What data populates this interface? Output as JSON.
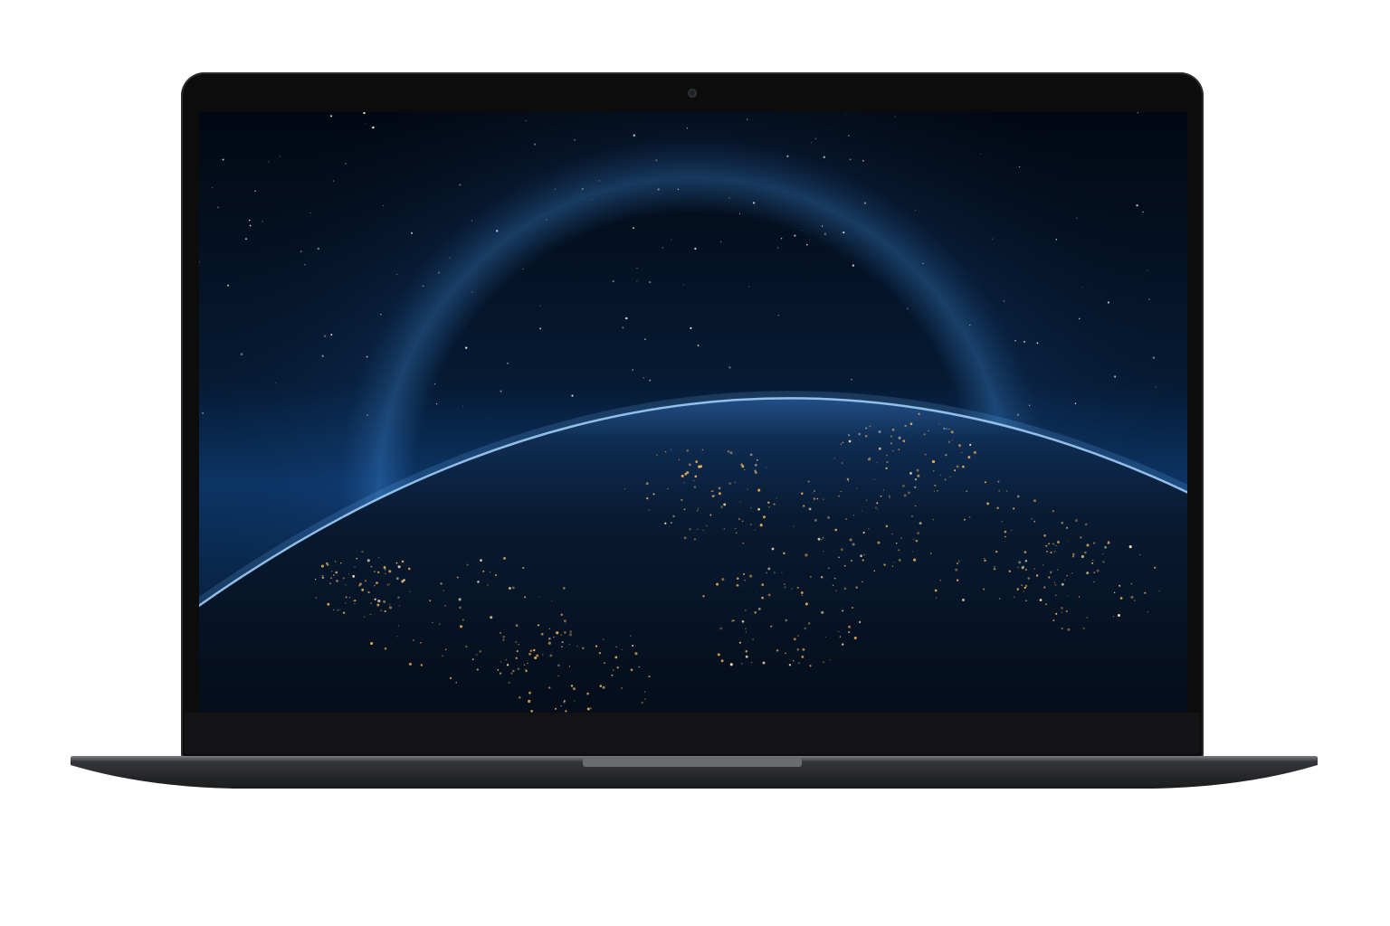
{
  "device": {
    "type": "laptop",
    "body_color": "#2b2c2f",
    "bezel_color": "#0c0c0d"
  },
  "wallpaper": {
    "subject": "earth-from-space-at-night",
    "sky_color": "#020a16",
    "atmosphere_glow_color": "#4a9be8",
    "city_lights_color": "#f2b45a"
  }
}
